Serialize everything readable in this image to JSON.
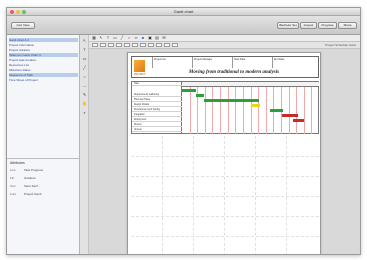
{
  "window": {
    "title": "Gantt chart"
  },
  "toolbar": {
    "left_button": "Cert View",
    "right_buttons": [
      "Bachelor Set",
      "Inspect",
      "Progress",
      "Share"
    ]
  },
  "sidebar": {
    "items": [
      {
        "label": "Gantt chart 4.4"
      },
      {
        "label": "Project Information"
      },
      {
        "label": "Project duration"
      },
      {
        "label": "Tasks per Gantt Chart 4"
      },
      {
        "label": "Project task duration"
      },
      {
        "label": "Resources List"
      },
      {
        "label": "Milestone Dates"
      },
      {
        "label": "Sequence of Task"
      },
      {
        "label": "Time Sheet of Project"
      }
    ],
    "attributes_title": "Attributes",
    "attributes": [
      {
        "key": "Line",
        "value": "Task Progress"
      },
      {
        "key": "Fill",
        "value": "Gradient"
      },
      {
        "key": "Text",
        "value": "Sans Serif"
      },
      {
        "key": "Font",
        "value": "Project Gantt"
      },
      {
        "key": "",
        "value": ""
      }
    ]
  },
  "main": {
    "zoom": "Project Schedule Gantt"
  },
  "document": {
    "logo_text": "PROJECT",
    "header_cells": [
      {
        "label": "Project No."
      },
      {
        "label": "Project Manager"
      },
      {
        "label": "Start Date"
      },
      {
        "label": "End Date"
      }
    ],
    "title": "Moving from traditional to modern analysis"
  },
  "gantt": {
    "tasks": [
      {
        "name": "Task"
      },
      {
        "name": "Requirements Gathering"
      },
      {
        "name": "Planning Phase"
      },
      {
        "name": "Design Models"
      },
      {
        "name": "Development and Testing"
      },
      {
        "name": "Integration"
      },
      {
        "name": "Deployment"
      },
      {
        "name": "Review"
      },
      {
        "name": "Closure"
      }
    ],
    "bars": [
      {
        "task": 1,
        "start": 0,
        "len": 0.1,
        "color": "#2e9e3c"
      },
      {
        "task": 2,
        "start": 0.1,
        "len": 0.06,
        "color": "#2e9e3c"
      },
      {
        "task": 3,
        "start": 0.16,
        "len": 0.4,
        "color": "#2e9e3c"
      },
      {
        "task": 4,
        "start": 0.5,
        "len": 0.07,
        "color": "#e8d81c"
      },
      {
        "task": 5,
        "start": 0.64,
        "len": 0.1,
        "color": "#2e9e3c"
      },
      {
        "task": 6,
        "start": 0.73,
        "len": 0.12,
        "color": "#c52b2b"
      },
      {
        "task": 7,
        "start": 0.81,
        "len": 0.08,
        "color": "#c52b2b"
      }
    ]
  }
}
